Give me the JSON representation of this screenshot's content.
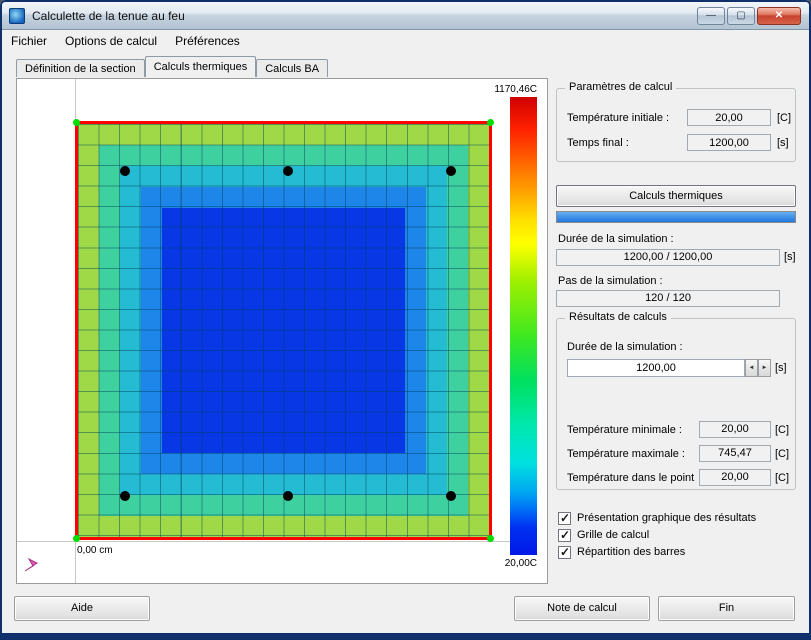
{
  "window": {
    "title": "Calculette de la tenue au feu",
    "minimize_glyph": "—",
    "maximize_glyph": "▢",
    "close_glyph": "✕"
  },
  "menu": {
    "items": [
      {
        "label": "Fichier"
      },
      {
        "label": "Options de calcul"
      },
      {
        "label": "Préférences"
      }
    ]
  },
  "tabs": [
    {
      "label": "Définition de la section",
      "active": false
    },
    {
      "label": "Calculs thermiques",
      "active": true
    },
    {
      "label": "Calculs BA",
      "active": false
    }
  ],
  "plot": {
    "colorbar_max": "1170,46C",
    "colorbar_min": "20,00C",
    "origin_label": "0,00 cm",
    "grid_cells": 20,
    "rebar_dots_count": 6,
    "colors": {
      "section_border": "#FF0000",
      "corner_markers": "#00DD00",
      "rebar_dots": "#000000",
      "core_fill": "#0838E6"
    }
  },
  "parametres": {
    "title": "Paramètres de calcul",
    "rows": [
      {
        "label": "Température initiale :",
        "value": "20,00",
        "unit": "[C]"
      },
      {
        "label": "Temps final :",
        "value": "1200,00",
        "unit": "[s]"
      }
    ]
  },
  "thermal": {
    "button_label": "Calculs thermiques",
    "progress_percent": 100,
    "duree_label": "Durée de la simulation :",
    "duree_value": "1200,00 / 1200,00",
    "duree_unit": "[s]",
    "pas_label": "Pas de la simulation :",
    "pas_value": "120 / 120"
  },
  "resultats": {
    "title": "Résultats de calculs",
    "duree_label": "Durée de la simulation :",
    "duree_value": "1200,00",
    "duree_unit": "[s]",
    "spinner_left": "◄",
    "spinner_right": "►",
    "temp_rows": [
      {
        "label": "Température minimale :",
        "value": "20,00",
        "unit": "[C]"
      },
      {
        "label": "Température maximale :",
        "value": "745,47",
        "unit": "[C]"
      },
      {
        "label": "Température dans le point",
        "value": "20,00",
        "unit": "[C]"
      }
    ]
  },
  "options": {
    "checkboxes": [
      {
        "label": "Présentation graphique des résultats",
        "checked": true
      },
      {
        "label": "Grille de calcul",
        "checked": true
      },
      {
        "label": "Répartition des barres",
        "checked": true
      }
    ]
  },
  "footer": {
    "aide": "Aide",
    "note": "Note de calcul",
    "fin": "Fin"
  }
}
